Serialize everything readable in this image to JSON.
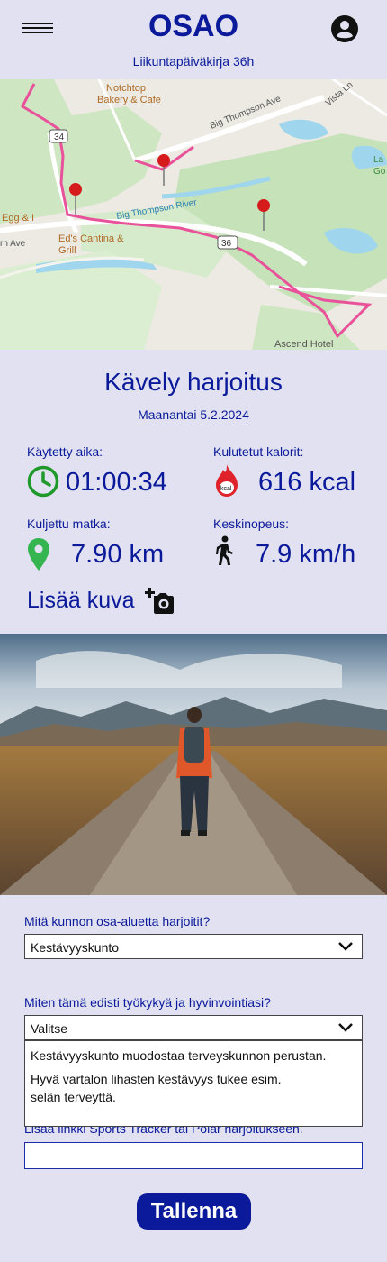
{
  "header": {
    "title": "OSAO",
    "subtitle": "Liikuntapäiväkirja 36h",
    "menu_icon": "hamburger-menu-icon",
    "profile_icon": "account-circle-icon"
  },
  "map": {
    "labels": {
      "notchtop": "Notchtop",
      "bakery": "Bakery & Cafe",
      "big_thompson_ave": "Big Thompson Ave",
      "vista_ln": "Vista Ln",
      "big_thompson_river": "Big Thompson River",
      "egg": "Egg & I",
      "eds": "Ed's Cantina &",
      "grill": "Grill",
      "rn_ave": "rn Ave",
      "route34": "34",
      "route36": "36",
      "ascend": "Ascend Hotel",
      "lake": "La",
      "lake2": "Go"
    },
    "route_color": "#e9529b",
    "pin_color": "#d51b1b"
  },
  "workout": {
    "title": "Kävely harjoitus",
    "date": "Maanantai 5.2.2024"
  },
  "stats": {
    "time_label": "Käytetty aika:",
    "time_value": "01:00:34",
    "calories_label": "Kulutetut kalorit:",
    "calories_value": "616 kcal",
    "calories_icon_text": "kcal",
    "distance_label": "Kuljettu matka:",
    "distance_value": "7.90 km",
    "speed_label": "Keskinopeus:",
    "speed_value": "7.9 km/h",
    "colors": {
      "clock": "#1f9a2a",
      "pin": "#34b550",
      "fire": "#e0232a"
    }
  },
  "photo": {
    "add_label": "Lisää kuva",
    "add_icon": "add-photo-camera-icon"
  },
  "form": {
    "q1_label": "Mitä kunnon osa-aluetta harjoitit?",
    "q1_value": "Kestävyyskunto",
    "q2_label": "Miten tämä edisti työkykyä ja hyvinvointiasi?",
    "q2_value": "Valitse",
    "q2_options": [
      "Kestävyyskunto muodostaa terveyskunnon perustan.",
      "Hyvä vartalon lihasten kestävyys tukee esim. selän terveyttä."
    ],
    "link_label": "Lisää linkki Sports Tracker tai Polar harjoitukseen.",
    "link_value": "",
    "save_label": "Tallenna"
  }
}
